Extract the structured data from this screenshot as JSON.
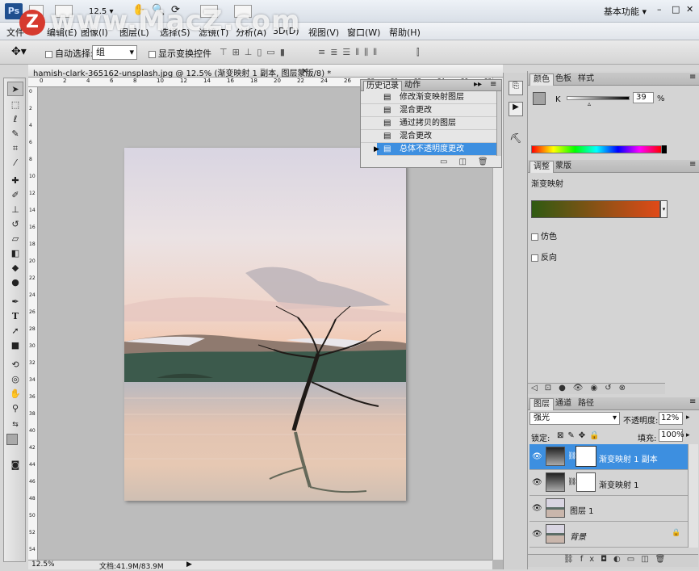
{
  "titlebar": {
    "logo": "Ps",
    "zoom": "12.5",
    "workspace": "基本功能",
    "watermark": "www.MacZ.com",
    "watermark_badge": "Z",
    "window_controls": {
      "minimize": "–",
      "restore": "□",
      "close": "✕"
    }
  },
  "menu": {
    "items": [
      "文件",
      "编辑(E)",
      "图像(I)",
      "图层(L)",
      "选择(S)",
      "滤镜(T)",
      "分析(A)",
      "3D(D)",
      "视图(V)",
      "窗口(W)",
      "帮助(H)"
    ]
  },
  "options": {
    "auto_select_label": "自动选择:",
    "auto_select_value": "组",
    "show_transform_label": "显示变换控件"
  },
  "document": {
    "tab_title": "hamish-clark-365162-unsplash.jpg @ 12.5% (渐变映射 1 副本, 图层蒙版/8) *",
    "close": "×",
    "ruler_top_labels": [
      "0",
      "2",
      "4",
      "6",
      "8",
      "10",
      "12",
      "14",
      "16",
      "18",
      "20",
      "22",
      "24",
      "26",
      "28",
      "30",
      "32",
      "34",
      "36",
      "38"
    ],
    "ruler_left_labels": [
      "0",
      "2",
      "4",
      "6",
      "8",
      "10",
      "12",
      "14",
      "16",
      "18",
      "20",
      "22",
      "24",
      "26",
      "28",
      "30",
      "32",
      "34",
      "36",
      "38",
      "40",
      "42",
      "44",
      "46",
      "48",
      "50",
      "52",
      "54"
    ],
    "zoom_status": "12.5%",
    "doc_status": "文档:41.9M/83.9M"
  },
  "history_panel": {
    "tabs": [
      "历史记录",
      "动作"
    ],
    "rows": [
      "修改渐变映射图层",
      "混合更改",
      "通过拷贝的图层",
      "混合更改",
      "总体不透明度更改"
    ],
    "selected_index": 4
  },
  "color_panel": {
    "tabs": [
      "颜色",
      "色板",
      "样式"
    ],
    "channel_label": "K",
    "value": "39",
    "unit": "%"
  },
  "adjust_panel": {
    "tabs": [
      "调整",
      "蒙版"
    ],
    "title": "渐变映射",
    "gradient_start": "#2f5a12",
    "gradient_end": "#e04a18",
    "dither_label": "仿色",
    "reverse_label": "反向"
  },
  "layers_panel": {
    "tabs": [
      "图层",
      "通道",
      "路径"
    ],
    "blend_mode": "强光",
    "opacity_label": "不透明度:",
    "opacity_value": "12%",
    "lock_label": "锁定:",
    "fill_label": "填充:",
    "fill_value": "100%",
    "layers": [
      {
        "name": "渐变映射 1 副本",
        "selected": true
      },
      {
        "name": "渐变映射 1",
        "selected": false
      },
      {
        "name": "图层 1",
        "selected": false
      },
      {
        "name": "背景",
        "selected": false,
        "italic": true
      }
    ]
  }
}
